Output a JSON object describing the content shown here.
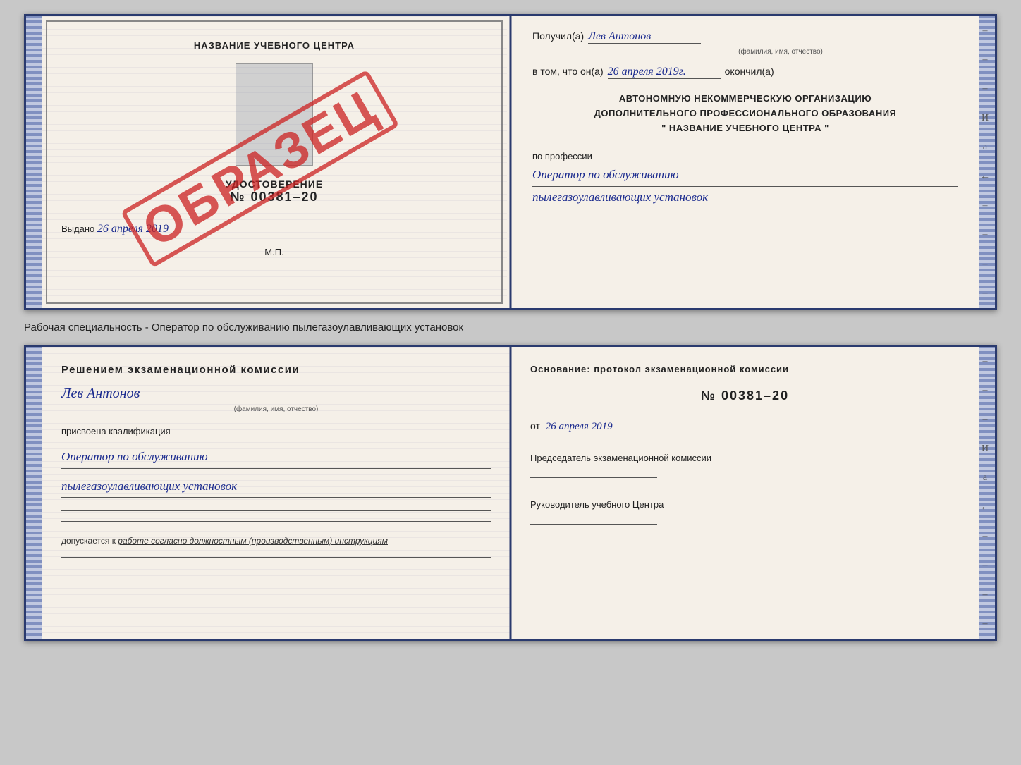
{
  "top_cert": {
    "left": {
      "title": "НАЗВАНИЕ УЧЕБНОГО ЦЕНТРА",
      "cert_label": "УДОСТОВЕРЕНИЕ",
      "cert_number": "№ 00381–20",
      "issued_text": "Выдано",
      "issued_date": "26 апреля 2019",
      "mp_label": "М.П.",
      "stamp_text": "ОБРАЗЕЦ"
    },
    "right": {
      "received_label": "Получил(а)",
      "recipient_name": "Лев Антонов",
      "name_sublabel": "(фамилия, имя, отчество)",
      "in_that_label": "в том, что он(а)",
      "completion_date": "26 апреля 2019г.",
      "finished_label": "окончил(а)",
      "org_line1": "АВТОНОМНУЮ НЕКОММЕРЧЕСКУЮ ОРГАНИЗАЦИЮ",
      "org_line2": "ДОПОЛНИТЕЛЬНОГО ПРОФЕССИОНАЛЬНОГО ОБРАЗОВАНИЯ",
      "org_name_quotes": "\"   НАЗВАНИЕ УЧЕБНОГО ЦЕНТРА   \"",
      "profession_label": "по профессии",
      "profession_line1": "Оператор по обслуживанию",
      "profession_line2": "пылегазоулавливающих установок"
    }
  },
  "specialty_text": "Рабочая специальность - Оператор по обслуживанию пылегазоулавливающих установок",
  "bottom_cert": {
    "left": {
      "decision_label": "Решением экзаменационной комиссии",
      "person_name": "Лев Антонов",
      "name_sublabel": "(фамилия, имя, отчество)",
      "qualification_label": "присвоена квалификация",
      "qual_line1": "Оператор по обслуживанию",
      "qual_line2": "пылегазоулавливающих установок",
      "allow_prefix": "допускается к",
      "allow_text": "работе согласно должностным (производственным) инструкциям"
    },
    "right": {
      "basis_label": "Основание: протокол экзаменационной комиссии",
      "protocol_number": "№  00381–20",
      "date_prefix": "от",
      "protocol_date": "26 апреля 2019",
      "chairman_label": "Председатель экзаменационной комиссии",
      "head_label": "Руководитель учебного Центра"
    }
  },
  "side_dashes": [
    "–",
    "–",
    "–",
    "И",
    "а",
    "←",
    "–",
    "–",
    "–",
    "–"
  ]
}
